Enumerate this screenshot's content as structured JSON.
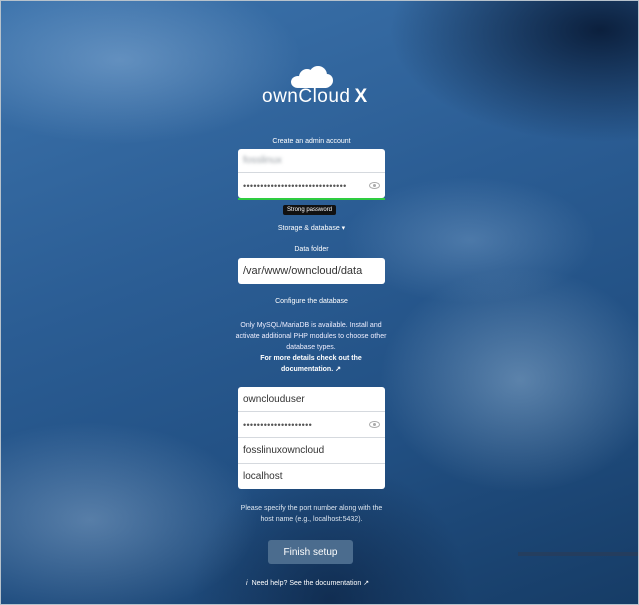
{
  "logo": {
    "wordmark": "ownCloud",
    "edition": "X"
  },
  "admin": {
    "heading": "Create an admin account",
    "username_blurred": "fosslinux",
    "password_dots": "••••••••••••••••••••••••••••••",
    "strength_tooltip": "Strong password"
  },
  "storage_toggle": "Storage & database ▾",
  "data_folder": {
    "label": "Data folder",
    "value": "/var/www/owncloud/data"
  },
  "database": {
    "heading": "Configure the database",
    "info": "Only MySQL/MariaDB is available. Install and activate additional PHP modules to choose other database types.",
    "doc_link": "For more details check out the documentation. ↗",
    "user": "ownclouduser",
    "password_dots": "••••••••••••••••••••",
    "name": "fosslinuxowncloud",
    "host": "localhost",
    "port_hint_line1": "Please specify the port number along with the",
    "port_hint_line2": "host name (e.g., localhost:5432)."
  },
  "finish_button": "Finish setup",
  "help": {
    "icon": "i",
    "text": "Need help? See the documentation ↗"
  }
}
